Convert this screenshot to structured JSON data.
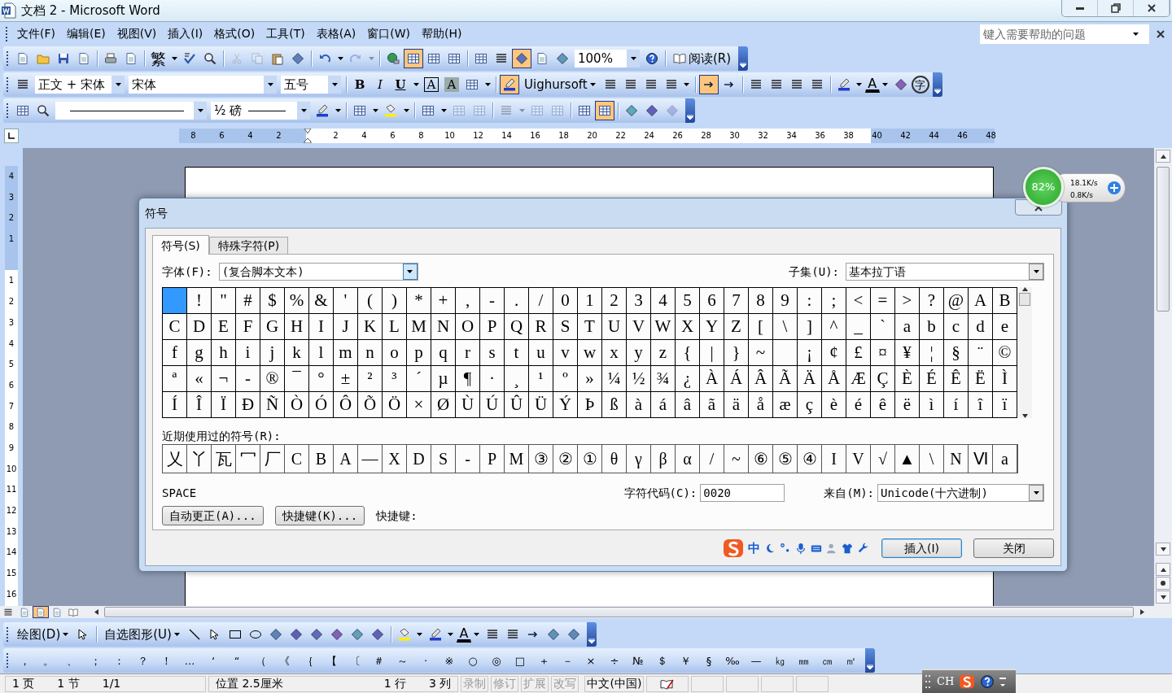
{
  "window": {
    "title": "文档 2 - Microsoft Word"
  },
  "menu": {
    "items": [
      "文件(F)",
      "编辑(E)",
      "视图(V)",
      "插入(I)",
      "格式(O)",
      "工具(T)",
      "表格(A)",
      "窗口(W)",
      "帮助(H)"
    ],
    "help_search": {
      "placeholder": "键入需要帮助的问题"
    }
  },
  "toolbars": [
    {
      "items": [
        {
          "kind": "button",
          "on": false,
          "disabled": false
        },
        {
          "kind": "button",
          "on": false,
          "disabled": false
        },
        {
          "kind": "button",
          "on": false,
          "disabled": false
        },
        {
          "kind": "button",
          "on": false,
          "disabled": false
        },
        {
          "kind": "separator"
        },
        {
          "kind": "button",
          "on": false,
          "disabled": false
        },
        {
          "kind": "button",
          "on": false,
          "disabled": false
        },
        {
          "kind": "separator"
        },
        {
          "kind": "glyph",
          "text": "繁",
          "on": false,
          "disabled": false
        },
        {
          "kind": "caret",
          "disabled": false
        },
        {
          "kind": "button",
          "disabled": false
        },
        {
          "kind": "button",
          "on": false,
          "disabled": false
        },
        {
          "kind": "separator"
        },
        {
          "kind": "button",
          "on": false,
          "disabled": true
        },
        {
          "kind": "button",
          "on": false,
          "disabled": true
        },
        {
          "kind": "button",
          "on": false,
          "disabled": false
        },
        {
          "kind": "button",
          "on": false,
          "disabled": false
        },
        {
          "kind": "separator"
        },
        {
          "kind": "button",
          "on": false,
          "disabled": false
        },
        {
          "kind": "caret",
          "disabled": false
        },
        {
          "kind": "button",
          "on": false,
          "disabled": true
        },
        {
          "kind": "caret",
          "disabled": true
        },
        {
          "kind": "separator"
        },
        {
          "kind": "button",
          "on": false,
          "disabled": false
        },
        {
          "kind": "button",
          "on": true,
          "disabled": false
        },
        {
          "kind": "button",
          "on": false,
          "disabled": false
        },
        {
          "kind": "button",
          "on": false,
          "disabled": false
        },
        {
          "kind": "separator"
        },
        {
          "kind": "button",
          "on": false,
          "disabled": false
        },
        {
          "kind": "button",
          "on": false,
          "disabled": false
        },
        {
          "kind": "button",
          "on": true,
          "disabled": false
        },
        {
          "kind": "button",
          "on": false,
          "disabled": false
        },
        {
          "kind": "button",
          "on": false,
          "disabled": false
        },
        {
          "kind": "combo",
          "value": "100%"
        },
        {
          "kind": "button",
          "on": false,
          "disabled": false
        },
        {
          "kind": "separator"
        },
        {
          "kind": "icon-text-button",
          "text": "阅读(R)"
        }
      ]
    },
    {
      "items": [
        {
          "kind": "button",
          "on": false,
          "disabled": false
        },
        {
          "kind": "combo",
          "value": "正文 + 宋体"
        },
        {
          "kind": "combo",
          "value": "宋体"
        },
        {
          "kind": "combo",
          "value": "五号"
        },
        {
          "kind": "separator"
        },
        {
          "kind": "glyph",
          "text": "B",
          "on": false,
          "disabled": false
        },
        {
          "kind": "glyph",
          "text": "I",
          "on": false,
          "disabled": false
        },
        {
          "kind": "glyph",
          "text": "U",
          "on": false,
          "disabled": false
        },
        {
          "kind": "caret",
          "disabled": false
        },
        {
          "kind": "glyph",
          "text": "A",
          "on": false,
          "disabled": false
        },
        {
          "kind": "glyph",
          "text": "A",
          "on": false,
          "disabled": false
        },
        {
          "kind": "button",
          "on": false,
          "disabled": false
        },
        {
          "kind": "caret",
          "disabled": false
        },
        {
          "kind": "separator"
        },
        {
          "kind": "button",
          "on": true,
          "disabled": false
        },
        {
          "kind": "menu-button",
          "text": "Uighursoft"
        },
        {
          "kind": "button",
          "on": false,
          "disabled": false
        },
        {
          "kind": "button",
          "on": false,
          "disabled": false
        },
        {
          "kind": "button",
          "on": false,
          "disabled": false
        },
        {
          "kind": "button",
          "on": false,
          "disabled": false
        },
        {
          "kind": "caret",
          "disabled": false
        },
        {
          "kind": "separator"
        },
        {
          "kind": "button",
          "on": true,
          "disabled": false
        },
        {
          "kind": "button",
          "on": false,
          "disabled": false
        },
        {
          "kind": "separator"
        },
        {
          "kind": "button",
          "on": false,
          "disabled": false
        },
        {
          "kind": "button",
          "on": false,
          "disabled": false
        },
        {
          "kind": "button",
          "on": false,
          "disabled": false
        },
        {
          "kind": "button",
          "on": false,
          "disabled": false
        },
        {
          "kind": "separator"
        },
        {
          "kind": "button",
          "on": false,
          "disabled": false
        },
        {
          "kind": "caret",
          "disabled": false
        },
        {
          "kind": "glyph",
          "text": "A",
          "on": false,
          "disabled": false
        },
        {
          "kind": "caret",
          "disabled": false
        },
        {
          "kind": "button",
          "on": false,
          "disabled": false
        },
        {
          "kind": "glyph",
          "text": "字",
          "on": false,
          "disabled": false
        }
      ]
    },
    {
      "items": [
        {
          "kind": "button",
          "on": false,
          "disabled": false
        },
        {
          "kind": "button",
          "on": false,
          "disabled": false
        },
        {
          "kind": "line-combo"
        },
        {
          "kind": "combo-line",
          "value": "½ 磅"
        },
        {
          "kind": "button",
          "on": false,
          "disabled": false
        },
        {
          "kind": "caret",
          "disabled": false
        },
        {
          "kind": "separator"
        },
        {
          "kind": "button",
          "on": false,
          "disabled": false
        },
        {
          "kind": "caret",
          "disabled": false
        },
        {
          "kind": "button",
          "on": false,
          "disabled": false
        },
        {
          "kind": "caret",
          "disabled": false
        },
        {
          "kind": "separator"
        },
        {
          "kind": "button",
          "on": false,
          "disabled": false
        },
        {
          "kind": "caret",
          "disabled": false
        },
        {
          "kind": "button",
          "on": false,
          "disabled": true
        },
        {
          "kind": "button",
          "on": false,
          "disabled": true
        },
        {
          "kind": "separator"
        },
        {
          "kind": "button",
          "on": false,
          "disabled": true
        },
        {
          "kind": "caret",
          "disabled": true
        },
        {
          "kind": "button",
          "on": false,
          "disabled": true
        },
        {
          "kind": "button",
          "on": false,
          "disabled": true
        },
        {
          "kind": "separator"
        },
        {
          "kind": "button",
          "on": false,
          "disabled": false
        },
        {
          "kind": "button",
          "on": true,
          "disabled": false
        },
        {
          "kind": "separator"
        },
        {
          "kind": "button",
          "on": false,
          "disabled": false
        },
        {
          "kind": "button",
          "on": false,
          "disabled": false
        },
        {
          "kind": "button",
          "on": false,
          "disabled": true
        }
      ]
    },
    {
      "items": [
        {
          "kind": "menu-button",
          "text": "绘图(D)"
        },
        {
          "kind": "button",
          "on": false,
          "disabled": false
        },
        {
          "kind": "separator"
        },
        {
          "kind": "menu-button",
          "text": "自选图形(U)"
        },
        {
          "kind": "button",
          "on": false,
          "disabled": false
        },
        {
          "kind": "button",
          "on": false,
          "disabled": false
        },
        {
          "kind": "button",
          "on": false,
          "disabled": false
        },
        {
          "kind": "button",
          "on": false,
          "disabled": false
        },
        {
          "kind": "button",
          "on": false,
          "disabled": false
        },
        {
          "kind": "button",
          "on": false,
          "disabled": false
        },
        {
          "kind": "button",
          "on": false,
          "disabled": false
        },
        {
          "kind": "button",
          "on": false,
          "disabled": false
        },
        {
          "kind": "button",
          "on": false,
          "disabled": false
        },
        {
          "kind": "button",
          "on": false,
          "disabled": false
        },
        {
          "kind": "separator"
        },
        {
          "kind": "button",
          "on": false,
          "disabled": false
        },
        {
          "kind": "caret",
          "disabled": false
        },
        {
          "kind": "button",
          "on": false,
          "disabled": false
        },
        {
          "kind": "caret",
          "disabled": false
        },
        {
          "kind": "glyph",
          "text": "A",
          "on": false,
          "disabled": false
        },
        {
          "kind": "caret",
          "disabled": false
        },
        {
          "kind": "button",
          "on": false,
          "disabled": false
        },
        {
          "kind": "button",
          "on": false,
          "disabled": false
        },
        {
          "kind": "button",
          "on": false,
          "disabled": false
        },
        {
          "kind": "button",
          "on": false,
          "disabled": false
        },
        {
          "kind": "button",
          "on": false,
          "disabled": false
        }
      ]
    },
    {
      "items": [
        {
          "kind": "symbol",
          "text": "，"
        },
        {
          "kind": "symbol",
          "text": "。"
        },
        {
          "kind": "symbol",
          "text": "、"
        },
        {
          "kind": "symbol",
          "text": "；"
        },
        {
          "kind": "symbol",
          "text": "："
        },
        {
          "kind": "symbol",
          "text": "？"
        },
        {
          "kind": "symbol",
          "text": "！"
        },
        {
          "kind": "symbol",
          "text": "…"
        },
        {
          "kind": "symbol",
          "text": "‘"
        },
        {
          "kind": "symbol",
          "text": "“"
        },
        {
          "kind": "symbol",
          "text": "（"
        },
        {
          "kind": "symbol",
          "text": "《"
        },
        {
          "kind": "symbol",
          "text": "｛"
        },
        {
          "kind": "symbol",
          "text": "【"
        },
        {
          "kind": "symbol",
          "text": "〔"
        },
        {
          "kind": "symbol",
          "text": "＃"
        },
        {
          "kind": "symbol",
          "text": "～"
        },
        {
          "kind": "symbol",
          "text": "·"
        },
        {
          "kind": "symbol",
          "text": "※"
        },
        {
          "kind": "symbol",
          "text": "○"
        },
        {
          "kind": "symbol",
          "text": "◎"
        },
        {
          "kind": "symbol",
          "text": "□"
        },
        {
          "kind": "symbol",
          "text": "＋"
        },
        {
          "kind": "symbol",
          "text": "－"
        },
        {
          "kind": "symbol",
          "text": "×"
        },
        {
          "kind": "symbol",
          "text": "÷"
        },
        {
          "kind": "symbol",
          "text": "№"
        },
        {
          "kind": "symbol",
          "text": "＄"
        },
        {
          "kind": "symbol",
          "text": "￥"
        },
        {
          "kind": "symbol",
          "text": "§"
        },
        {
          "kind": "symbol",
          "text": "‰"
        },
        {
          "kind": "symbol",
          "text": "—"
        },
        {
          "kind": "symbol",
          "text": "㎏"
        },
        {
          "kind": "symbol",
          "text": "㎜"
        },
        {
          "kind": "symbol",
          "text": "㎝"
        },
        {
          "kind": "symbol",
          "text": "㎡"
        }
      ]
    }
  ],
  "ruler": {
    "left_labels": [
      "8",
      "6",
      "4",
      "2"
    ],
    "right_labels": [
      "2",
      "4",
      "6",
      "8",
      "10",
      "12",
      "14",
      "16",
      "18",
      "20",
      "22",
      "24",
      "26",
      "28",
      "30",
      "32",
      "34",
      "36",
      "38",
      "40",
      "42",
      "44",
      "46",
      "48"
    ]
  },
  "vertical_ruler": {
    "top_labels": [
      "4",
      "3",
      "2",
      "1"
    ],
    "bottom_labels": [
      "1",
      "2",
      "3",
      "4",
      "5",
      "6",
      "7",
      "8",
      "9",
      "10",
      "11",
      "12",
      "13",
      "14",
      "15",
      "16"
    ]
  },
  "network_widget": {
    "percent": "82%",
    "upload": "18.1K/s",
    "download": "0.8K/s"
  },
  "dialog": {
    "title": "符号",
    "tabs": [
      {
        "label": "符号(S)",
        "selected": true
      },
      {
        "label": "特殊字符(P)",
        "selected": false
      }
    ],
    "font": {
      "label": "字体(F):",
      "value": "(复合脚本文本)"
    },
    "subset": {
      "label": "子集(U):",
      "value": "基本拉丁语"
    },
    "grid": {
      "rows": [
        [
          {
            "selected": true
          },
          {
            "char": "!",
            "selected": false
          },
          {
            "char": "\"",
            "selected": false
          },
          {
            "char": "#",
            "selected": false
          },
          {
            "char": "$",
            "selected": false
          },
          {
            "char": "%",
            "selected": false
          },
          {
            "char": "&",
            "selected": false
          },
          {
            "char": "'",
            "selected": false
          },
          {
            "char": "(",
            "selected": false
          },
          {
            "char": ")",
            "selected": false
          },
          {
            "char": "*",
            "selected": false
          },
          {
            "char": "+",
            "selected": false
          },
          {
            "char": ",",
            "selected": false
          },
          {
            "char": "-",
            "selected": false
          },
          {
            "char": ".",
            "selected": false
          },
          {
            "char": "/",
            "selected": false
          },
          {
            "char": "0",
            "selected": false
          },
          {
            "char": "1",
            "selected": false
          },
          {
            "char": "2",
            "selected": false
          },
          {
            "char": "3",
            "selected": false
          },
          {
            "char": "4",
            "selected": false
          },
          {
            "char": "5",
            "selected": false
          },
          {
            "char": "6",
            "selected": false
          },
          {
            "char": "7",
            "selected": false
          },
          {
            "char": "8",
            "selected": false
          },
          {
            "char": "9",
            "selected": false
          },
          {
            "char": ":",
            "selected": false
          },
          {
            "char": ";",
            "selected": false
          },
          {
            "char": "<",
            "selected": false
          },
          {
            "char": "=",
            "selected": false
          },
          {
            "char": ">",
            "selected": false
          },
          {
            "char": "?",
            "selected": false
          },
          {
            "char": "@",
            "selected": false
          },
          {
            "char": "A",
            "selected": false
          },
          {
            "char": "B",
            "selected": false
          }
        ],
        [
          {
            "char": "C",
            "selected": false
          },
          {
            "char": "D",
            "selected": false
          },
          {
            "char": "E",
            "selected": false
          },
          {
            "char": "F",
            "selected": false
          },
          {
            "char": "G",
            "selected": false
          },
          {
            "char": "H",
            "selected": false
          },
          {
            "char": "I",
            "selected": false
          },
          {
            "char": "J",
            "selected": false
          },
          {
            "char": "K",
            "selected": false
          },
          {
            "char": "L",
            "selected": false
          },
          {
            "char": "M",
            "selected": false
          },
          {
            "char": "N",
            "selected": false
          },
          {
            "char": "O",
            "selected": false
          },
          {
            "char": "P",
            "selected": false
          },
          {
            "char": "Q",
            "selected": false
          },
          {
            "char": "R",
            "selected": false
          },
          {
            "char": "S",
            "selected": false
          },
          {
            "char": "T",
            "selected": false
          },
          {
            "char": "U",
            "selected": false
          },
          {
            "char": "V",
            "selected": false
          },
          {
            "char": "W",
            "selected": false
          },
          {
            "char": "X",
            "selected": false
          },
          {
            "char": "Y",
            "selected": false
          },
          {
            "char": "Z",
            "selected": false
          },
          {
            "char": "[",
            "selected": false
          },
          {
            "char": "\\",
            "selected": false
          },
          {
            "char": "]",
            "selected": false
          },
          {
            "char": "^",
            "selected": false
          },
          {
            "char": "_",
            "selected": false
          },
          {
            "char": "`",
            "selected": false
          },
          {
            "char": "a",
            "selected": false
          },
          {
            "char": "b",
            "selected": false
          },
          {
            "char": "c",
            "selected": false
          },
          {
            "char": "d",
            "selected": false
          },
          {
            "char": "e",
            "selected": false
          }
        ],
        [
          {
            "char": "f",
            "selected": false
          },
          {
            "char": "g",
            "selected": false
          },
          {
            "char": "h",
            "selected": false
          },
          {
            "char": "i",
            "selected": false
          },
          {
            "char": "j",
            "selected": false
          },
          {
            "char": "k",
            "selected": false
          },
          {
            "char": "l",
            "selected": false
          },
          {
            "char": "m",
            "selected": false
          },
          {
            "char": "n",
            "selected": false
          },
          {
            "char": "o",
            "selected": false
          },
          {
            "char": "p",
            "selected": false
          },
          {
            "char": "q",
            "selected": false
          },
          {
            "char": "r",
            "selected": false
          },
          {
            "char": "s",
            "selected": false
          },
          {
            "char": "t",
            "selected": false
          },
          {
            "char": "u",
            "selected": false
          },
          {
            "char": "v",
            "selected": false
          },
          {
            "char": "w",
            "selected": false
          },
          {
            "char": "x",
            "selected": false
          },
          {
            "char": "y",
            "selected": false
          },
          {
            "char": "z",
            "selected": false
          },
          {
            "char": "{",
            "selected": false
          },
          {
            "char": "|",
            "selected": false
          },
          {
            "char": "}",
            "selected": false
          },
          {
            "char": "~",
            "selected": false
          },
          {
            "selected": false
          },
          {
            "char": "¡",
            "selected": false
          },
          {
            "char": "¢",
            "selected": false
          },
          {
            "char": "£",
            "selected": false
          },
          {
            "char": "¤",
            "selected": false
          },
          {
            "char": "¥",
            "selected": false
          },
          {
            "char": "¦",
            "selected": false
          },
          {
            "char": "§",
            "selected": false
          },
          {
            "char": "¨",
            "selected": false
          },
          {
            "char": "©",
            "selected": false
          }
        ],
        [
          {
            "char": "ª",
            "selected": false
          },
          {
            "char": "«",
            "selected": false
          },
          {
            "char": "¬",
            "selected": false
          },
          {
            "char": "-",
            "selected": false
          },
          {
            "char": "®",
            "selected": false
          },
          {
            "char": "¯",
            "selected": false
          },
          {
            "char": "°",
            "selected": false
          },
          {
            "char": "±",
            "selected": false
          },
          {
            "char": "²",
            "selected": false
          },
          {
            "char": "³",
            "selected": false
          },
          {
            "char": "´",
            "selected": false
          },
          {
            "char": "µ",
            "selected": false
          },
          {
            "char": "¶",
            "selected": false
          },
          {
            "char": "·",
            "selected": false
          },
          {
            "char": "¸",
            "selected": false
          },
          {
            "char": "¹",
            "selected": false
          },
          {
            "char": "º",
            "selected": false
          },
          {
            "char": "»",
            "selected": false
          },
          {
            "char": "¼",
            "selected": false
          },
          {
            "char": "½",
            "selected": false
          },
          {
            "char": "¾",
            "selected": false
          },
          {
            "char": "¿",
            "selected": false
          },
          {
            "char": "À",
            "selected": false
          },
          {
            "char": "Á",
            "selected": false
          },
          {
            "char": "Â",
            "selected": false
          },
          {
            "char": "Ã",
            "selected": false
          },
          {
            "char": "Ä",
            "selected": false
          },
          {
            "char": "Å",
            "selected": false
          },
          {
            "char": "Æ",
            "selected": false
          },
          {
            "char": "Ç",
            "selected": false
          },
          {
            "char": "È",
            "selected": false
          },
          {
            "char": "É",
            "selected": false
          },
          {
            "char": "Ê",
            "selected": false
          },
          {
            "char": "Ë",
            "selected": false
          },
          {
            "char": "Ì",
            "selected": false
          }
        ],
        [
          {
            "char": "Í",
            "selected": false
          },
          {
            "char": "Î",
            "selected": false
          },
          {
            "char": "Ï",
            "selected": false
          },
          {
            "char": "Ð",
            "selected": false
          },
          {
            "char": "Ñ",
            "selected": false
          },
          {
            "char": "Ò",
            "selected": false
          },
          {
            "char": "Ó",
            "selected": false
          },
          {
            "char": "Ô",
            "selected": false
          },
          {
            "char": "Õ",
            "selected": false
          },
          {
            "char": "Ö",
            "selected": false
          },
          {
            "char": "×",
            "selected": false
          },
          {
            "char": "Ø",
            "selected": false
          },
          {
            "char": "Ù",
            "selected": false
          },
          {
            "char": "Ú",
            "selected": false
          },
          {
            "char": "Û",
            "selected": false
          },
          {
            "char": "Ü",
            "selected": false
          },
          {
            "char": "Ý",
            "selected": false
          },
          {
            "char": "Þ",
            "selected": false
          },
          {
            "char": "ß",
            "selected": false
          },
          {
            "char": "à",
            "selected": false
          },
          {
            "char": "á",
            "selected": false
          },
          {
            "char": "â",
            "selected": false
          },
          {
            "char": "ã",
            "selected": false
          },
          {
            "char": "ä",
            "selected": false
          },
          {
            "char": "å",
            "selected": false
          },
          {
            "char": "æ",
            "selected": false
          },
          {
            "char": "ç",
            "selected": false
          },
          {
            "char": "è",
            "selected": false
          },
          {
            "char": "é",
            "selected": false
          },
          {
            "char": "ê",
            "selected": false
          },
          {
            "char": "ë",
            "selected": false
          },
          {
            "char": "ì",
            "selected": false
          },
          {
            "char": "í",
            "selected": false
          },
          {
            "char": "î",
            "selected": false
          },
          {
            "char": "ï",
            "selected": false
          }
        ]
      ]
    },
    "recent": {
      "label": "近期使用过的符号(R):",
      "symbols": [
        "乂",
        "丫",
        "瓦",
        "冖",
        "厂",
        "C",
        "B",
        "A",
        "—",
        "X",
        "D",
        "S",
        "-",
        "P",
        "M",
        "③",
        "②",
        "①",
        "θ",
        "γ",
        "β",
        "α",
        "/",
        "~",
        "⑥",
        "⑤",
        "④",
        "I",
        "V",
        "√",
        "▲",
        "\\",
        "N",
        "Ⅵ",
        "a"
      ]
    },
    "char_name": "SPACE",
    "char_code": {
      "label": "字符代码(C):",
      "value": "0020"
    },
    "from": {
      "label": "来自(M):",
      "value": "Unicode(十六进制)"
    },
    "buttons": [
      "自动更正(A)...",
      "快捷键(K)..."
    ],
    "shortcut_label": "快捷键:",
    "ime_toolbar": {
      "text": "中"
    },
    "actions": [
      "插入(I)",
      "关闭"
    ]
  },
  "view_buttons": [
    {
      "selected": false
    },
    {
      "selected": false
    },
    {
      "selected": true
    },
    {
      "selected": false
    },
    {
      "selected": false
    }
  ],
  "status_bar": {
    "page_info": [
      "1 页",
      "1 节",
      "1/1"
    ],
    "position": [
      "位置 2.5厘米",
      "1 行",
      "3 列"
    ],
    "modes": [
      {
        "text": "录制",
        "on": false
      },
      {
        "text": "修订",
        "on": false
      },
      {
        "text": "扩展",
        "on": false
      },
      {
        "text": "改写",
        "on": false
      }
    ],
    "language": "中文(中国)"
  },
  "ime_bar": {
    "text": "CH"
  }
}
